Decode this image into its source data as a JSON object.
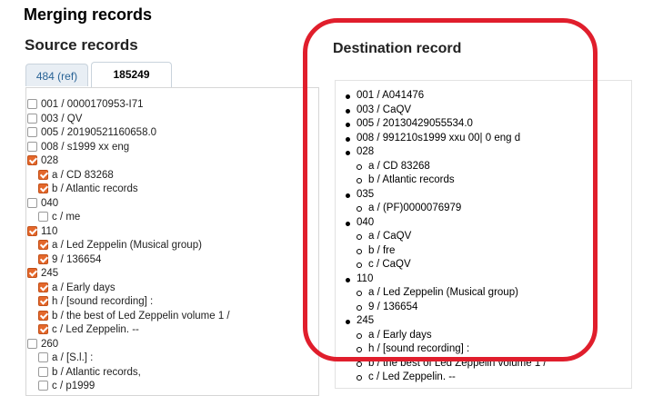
{
  "page_title": "Merging records",
  "source": {
    "heading": "Source records",
    "tabs": [
      {
        "label": "484 (ref)",
        "active": false
      },
      {
        "label": "185249",
        "active": true
      }
    ],
    "items": [
      {
        "text": "001 / 0000170953-I71",
        "checked": false,
        "level": 1
      },
      {
        "text": "003 / QV",
        "checked": false,
        "level": 1
      },
      {
        "text": "005 / 20190521160658.0",
        "checked": false,
        "level": 1
      },
      {
        "text": "008 / s1999 xx eng",
        "checked": false,
        "level": 1
      },
      {
        "text": "028",
        "checked": true,
        "level": 1
      },
      {
        "text": "a / CD 83268",
        "checked": true,
        "level": 2
      },
      {
        "text": "b / Atlantic records",
        "checked": true,
        "level": 2
      },
      {
        "text": "040",
        "checked": false,
        "level": 1
      },
      {
        "text": "c / me",
        "checked": false,
        "level": 2
      },
      {
        "text": "110",
        "checked": true,
        "level": 1
      },
      {
        "text": "a / Led Zeppelin (Musical group)",
        "checked": true,
        "level": 2
      },
      {
        "text": "9 / 136654",
        "checked": true,
        "level": 2
      },
      {
        "text": "245",
        "checked": true,
        "level": 1
      },
      {
        "text": "a / Early days",
        "checked": true,
        "level": 2
      },
      {
        "text": "h / [sound recording] :",
        "checked": true,
        "level": 2
      },
      {
        "text": "b / the best of Led Zeppelin volume 1 /",
        "checked": true,
        "level": 2
      },
      {
        "text": "c / Led Zeppelin. --",
        "checked": true,
        "level": 2
      },
      {
        "text": "260",
        "checked": false,
        "level": 1
      },
      {
        "text": "a / [S.l.] :",
        "checked": false,
        "level": 2
      },
      {
        "text": "b / Atlantic records,",
        "checked": false,
        "level": 2
      },
      {
        "text": "c / p1999",
        "checked": false,
        "level": 2
      }
    ]
  },
  "destination": {
    "heading": "Destination record",
    "items": [
      {
        "text": "001 / A041476",
        "level": 1
      },
      {
        "text": "003 / CaQV",
        "level": 1
      },
      {
        "text": "005 / 20130429055534.0",
        "level": 1
      },
      {
        "text": "008 / 991210s1999 xxu 00| 0 eng d",
        "level": 1
      },
      {
        "text": "028",
        "level": 1
      },
      {
        "text": "a / CD 83268",
        "level": 2
      },
      {
        "text": "b / Atlantic records",
        "level": 2
      },
      {
        "text": "035",
        "level": 1
      },
      {
        "text": "a / (PF)0000076979",
        "level": 2
      },
      {
        "text": "040",
        "level": 1
      },
      {
        "text": "a / CaQV",
        "level": 2
      },
      {
        "text": "b / fre",
        "level": 2
      },
      {
        "text": "c / CaQV",
        "level": 2
      },
      {
        "text": "110",
        "level": 1
      },
      {
        "text": "a / Led Zeppelin (Musical group)",
        "level": 2
      },
      {
        "text": "9 / 136654",
        "level": 2
      },
      {
        "text": "245",
        "level": 1
      },
      {
        "text": "a / Early days",
        "level": 2
      },
      {
        "text": "h / [sound recording] :",
        "level": 2
      },
      {
        "text": "b / the best of Led Zeppelin volume 1 /",
        "level": 2
      },
      {
        "text": "c / Led Zeppelin. --",
        "level": 2
      }
    ]
  },
  "colors": {
    "checkbox_checked": "#e4682c",
    "highlight_ring": "#e01e2c",
    "tab_link": "#2a6496"
  }
}
